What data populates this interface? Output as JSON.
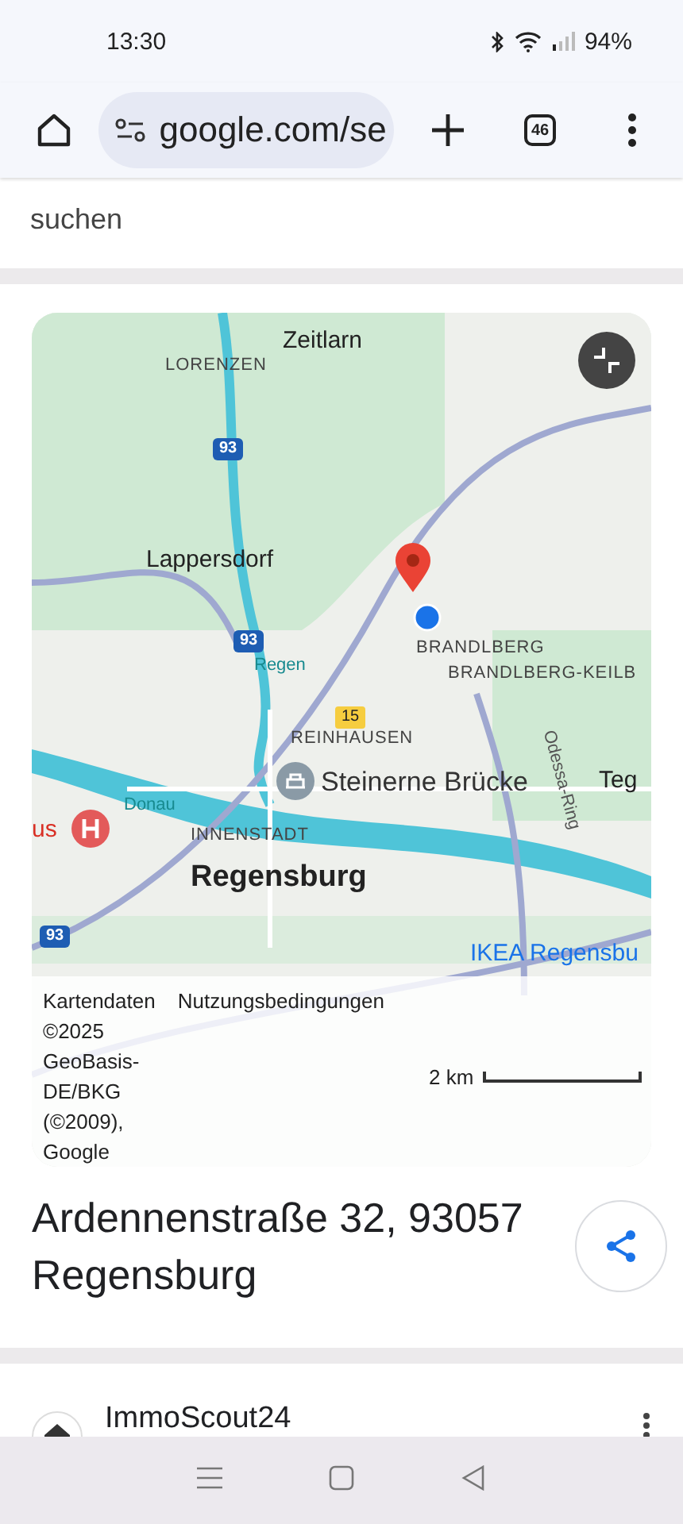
{
  "status_bar": {
    "time": "13:30",
    "battery": "94%"
  },
  "toolbar": {
    "url": "google.com/se",
    "tab_count": "46"
  },
  "snippet": {
    "text": "suchen"
  },
  "map": {
    "labels": [
      {
        "kind": "town",
        "text": "Zeitlarn"
      },
      {
        "kind": "district",
        "text": "LORENZEN"
      },
      {
        "kind": "town",
        "text": "Lappersdorf"
      },
      {
        "kind": "district",
        "text": "BRANDLBERG"
      },
      {
        "kind": "district",
        "text": "BRANDLBERG-KEILB"
      },
      {
        "kind": "district",
        "text": "REINHAUSEN"
      },
      {
        "kind": "poi",
        "text": "Steinerne Brücke"
      },
      {
        "kind": "district",
        "text": "INNENSTADT"
      },
      {
        "kind": "city",
        "text": "Regensburg"
      },
      {
        "kind": "town",
        "text": "Teg"
      },
      {
        "kind": "street",
        "text": "Odessa-Ring"
      },
      {
        "kind": "water",
        "text": "Donau"
      },
      {
        "kind": "water",
        "text": "Regen"
      },
      {
        "kind": "shop",
        "text": "IKEA Regensbu"
      },
      {
        "kind": "shield",
        "text": "93"
      },
      {
        "kind": "shield",
        "text": "93"
      },
      {
        "kind": "shield",
        "text": "93"
      },
      {
        "kind": "yshield",
        "text": "15"
      },
      {
        "kind": "hospital",
        "text": "us"
      }
    ],
    "attribution": [
      "Kartendaten",
      "Nutzungsbedingungen"
    ],
    "copyright": "©2025 GeoBasis-DE/BKG (©2009), Google",
    "scale": "2 km"
  },
  "address": "Ardennenstraße 32, 93057 Regensburg",
  "result": {
    "title": "ImmoScout24"
  }
}
